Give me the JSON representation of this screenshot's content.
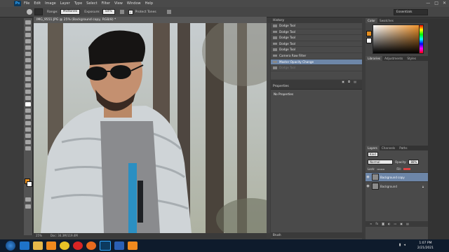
{
  "app": {
    "logo": "Ps"
  },
  "menu": [
    "File",
    "Edit",
    "Image",
    "Layer",
    "Type",
    "Select",
    "Filter",
    "View",
    "Window",
    "Help"
  ],
  "window_controls": [
    "—",
    "□",
    "✕"
  ],
  "options_bar": {
    "range_label": "Range:",
    "range_value": "Midtones",
    "exposure_label": "Exposure:",
    "exposure_value": "50%",
    "protect_tones_label": "Protect Tones",
    "workspace": "Essentials"
  },
  "document": {
    "tab_title": "IMG_9551.JPG @ 25% (Background copy, RGB/8) *",
    "zoom": "25%",
    "doc_size": "Doc: 34.3M/119.4M"
  },
  "history": {
    "items": [
      {
        "label": "Dodge Tool",
        "state": "normal"
      },
      {
        "label": "Dodge Tool",
        "state": "normal"
      },
      {
        "label": "Dodge Tool",
        "state": "normal"
      },
      {
        "label": "Dodge Tool",
        "state": "normal"
      },
      {
        "label": "Dodge Tool",
        "state": "normal"
      },
      {
        "label": "Camera Raw Filter",
        "state": "normal"
      },
      {
        "label": "Master Opacity Change",
        "state": "active"
      },
      {
        "label": "Dodge Tool",
        "state": "dim"
      }
    ]
  },
  "properties": {
    "title": "Properties",
    "body": "No Properties"
  },
  "bottom_panel": {
    "label": "Brush"
  },
  "color_panel": {
    "tabs": [
      "Color",
      "Swatches"
    ]
  },
  "libraries_panel": {
    "tabs": [
      "Libraries",
      "Adjustments",
      "Styles"
    ]
  },
  "layers_panel": {
    "tabs": [
      "Layers",
      "Channels",
      "Paths"
    ],
    "filter": "Kind",
    "blend_mode": "Normal",
    "opacity_label": "Opacity:",
    "opacity_value": "88%",
    "lock_label": "Lock:",
    "fill_label": "Fill:",
    "layers": [
      {
        "name": "Background copy",
        "selected": true
      },
      {
        "name": "Background",
        "selected": false
      }
    ]
  },
  "taskbar": {
    "time": "1:07 PM",
    "date": "2/21/2021",
    "apps": [
      {
        "icon": "ie-icon",
        "color": "#1e73c8"
      },
      {
        "icon": "explorer-icon",
        "color": "#e6b84a"
      },
      {
        "icon": "media-player-icon",
        "color": "#f08a1e"
      },
      {
        "icon": "chrome-icon",
        "color": "#e8c227"
      },
      {
        "icon": "opera-icon",
        "color": "#d82424"
      },
      {
        "icon": "firefox-icon",
        "color": "#e86a1e"
      },
      {
        "icon": "photoshop-icon",
        "color": "#0c3a5f"
      },
      {
        "icon": "word-icon",
        "color": "#2b5fb4"
      },
      {
        "icon": "vlc-icon",
        "color": "#f0891e"
      }
    ]
  }
}
